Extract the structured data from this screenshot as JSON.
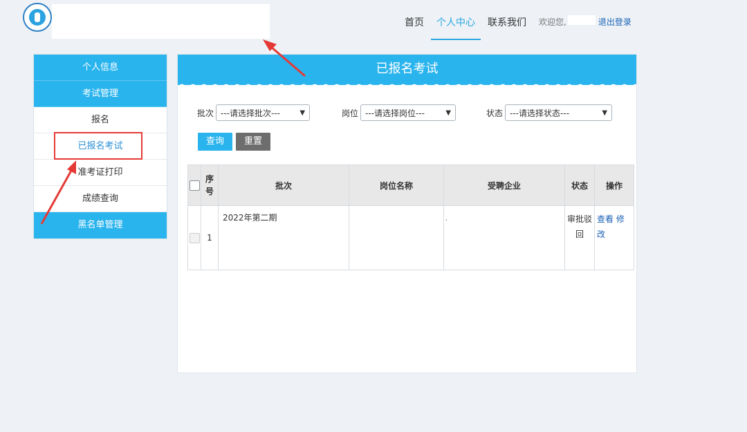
{
  "header": {
    "nav": [
      "首页",
      "个人中心",
      "联系我们"
    ],
    "active_nav": "个人中心",
    "welcome": "欢迎您,",
    "logout": "退出登录"
  },
  "sidebar": {
    "items": [
      {
        "label": "个人信息",
        "style": "blue"
      },
      {
        "label": "考试管理",
        "style": "blue"
      },
      {
        "label": "报名",
        "style": "normal"
      },
      {
        "label": "已报名考试",
        "style": "current"
      },
      {
        "label": "准考证打印",
        "style": "normal"
      },
      {
        "label": "成绩查询",
        "style": "normal"
      },
      {
        "label": "黑名单管理",
        "style": "blue"
      }
    ]
  },
  "panel": {
    "title": "已报名考试",
    "filters": {
      "batch_label": "批次",
      "batch_value": "---请选择批次---",
      "position_label": "岗位",
      "position_value": "---请选择岗位---",
      "status_label": "状态",
      "status_value": "---请选择状态---"
    },
    "buttons": {
      "query": "查询",
      "reset": "重置"
    },
    "table": {
      "headers": [
        "序号",
        "批次",
        "岗位名称",
        "受聘企业",
        "状态",
        "操作"
      ],
      "rows": [
        {
          "index": "1",
          "batch": "2022年第二期",
          "position": "",
          "company": ".",
          "status": "审批驳回",
          "action_view": "查看",
          "action_edit": "修改"
        }
      ]
    }
  },
  "colors": {
    "accent": "#2ab4ee",
    "highlight": "#e53935",
    "link": "#1a62b5"
  }
}
